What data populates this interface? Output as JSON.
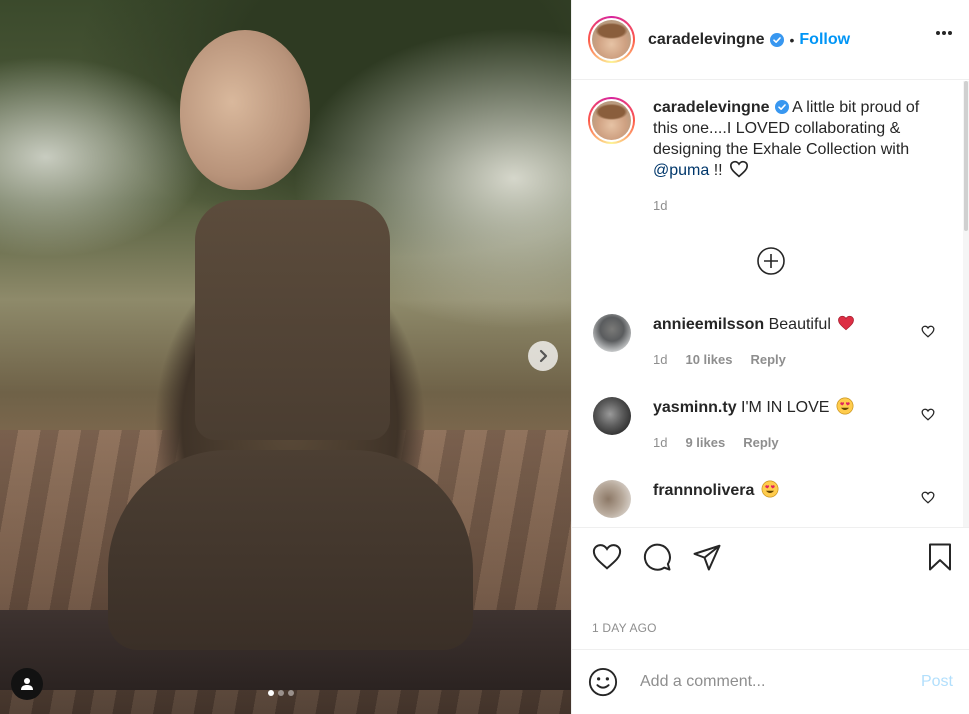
{
  "post": {
    "username": "caradelevingne",
    "follow_label": "Follow",
    "separator": "•",
    "caption_text": "A little bit proud of this one....I LOVED collaborating & designing the Exhale Collection with",
    "caption_mention": "@puma",
    "caption_suffix": "!!",
    "caption_age": "1d",
    "time_ago": "1 DAY AGO",
    "image_dots": 3,
    "active_dot": 0
  },
  "comments": [
    {
      "username": "annieemilsson",
      "text": "Beautiful",
      "emoji": "red-heart-emoji",
      "age": "1d",
      "likes": "10 likes",
      "reply": "Reply"
    },
    {
      "username": "yasminn.ty",
      "text": "I'M IN LOVE",
      "emoji": "heart-eyes-emoji",
      "age": "1d",
      "likes": "9 likes",
      "reply": "Reply"
    },
    {
      "username": "frannnolivera",
      "text": "",
      "emoji": "heart-eyes-emoji"
    }
  ],
  "add_comment": {
    "placeholder": "Add a comment...",
    "post_label": "Post"
  },
  "colors": {
    "link_blue": "#0095f6",
    "mention_blue": "#00376b",
    "muted": "#8e8e8e",
    "post_disabled": "#b2dffc",
    "heart_red": "#ed4956"
  }
}
